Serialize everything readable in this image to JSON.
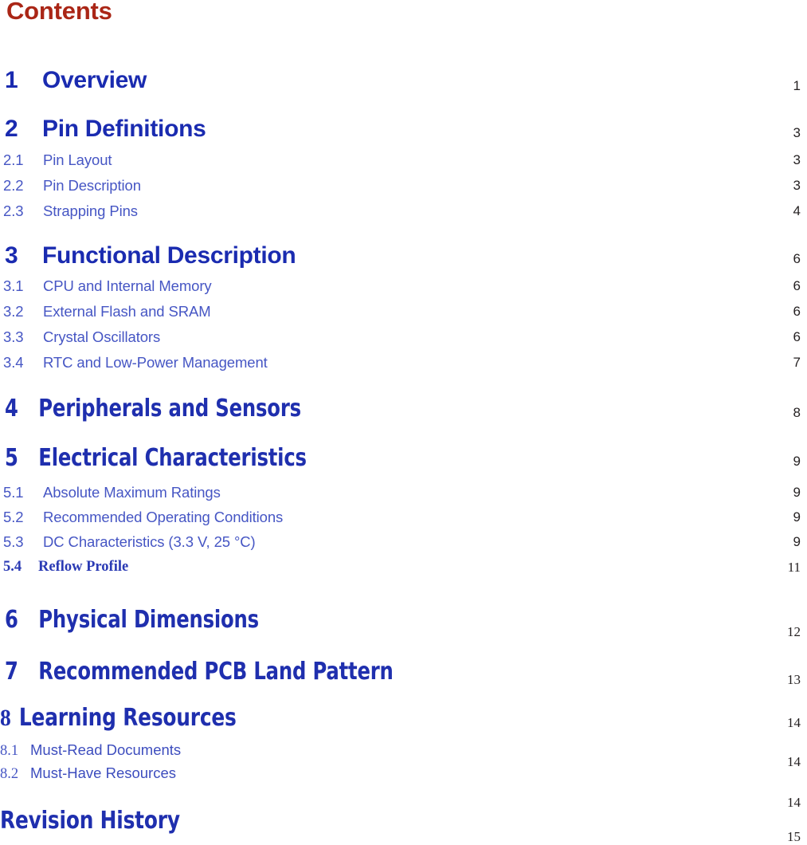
{
  "document": {
    "title": "Contents",
    "title_color": "#aa2616",
    "section_color": "#1f2fae",
    "subsection_color": "#4656c4",
    "pagenum_color": "#231f20"
  },
  "entries": [
    {
      "id": "overview",
      "number": "1",
      "label": "Overview",
      "page": "1",
      "level": 1
    },
    {
      "id": "pin-definitions",
      "number": "2",
      "label": "Pin Definitions",
      "page": "3",
      "level": 1
    },
    {
      "id": "pin-layout",
      "number": "2.1",
      "label": "Pin Layout",
      "page": "3",
      "level": 2
    },
    {
      "id": "pin-description",
      "number": "2.2",
      "label": "Pin Description",
      "page": "3",
      "level": 2
    },
    {
      "id": "strapping-pins",
      "number": "2.3",
      "label": "Strapping Pins",
      "page": "4",
      "level": 2
    },
    {
      "id": "functional-description",
      "number": "3",
      "label": "Functional Description",
      "page": "6",
      "level": 1
    },
    {
      "id": "cpu-internal-memory",
      "number": "3.1",
      "label": "CPU and Internal Memory",
      "page": "6",
      "level": 2
    },
    {
      "id": "external-flash-sram",
      "number": "3.2",
      "label": "External Flash and SRAM",
      "page": "6",
      "level": 2
    },
    {
      "id": "crystal-oscillators",
      "number": "3.3",
      "label": "Crystal Oscillators",
      "page": "6",
      "level": 2
    },
    {
      "id": "rtc-low-power",
      "number": "3.4",
      "label": "RTC and Low-Power Management",
      "page": "7",
      "level": 2
    },
    {
      "id": "peripherals-sensors",
      "number": "4",
      "label": "Peripherals and Sensors",
      "page": "8",
      "level": 1
    },
    {
      "id": "electrical-characteristics",
      "number": "5",
      "label": "Electrical Characteristics",
      "page": "9",
      "level": 1
    },
    {
      "id": "absolute-maximum-ratings",
      "number": "5.1",
      "label": "Absolute Maximum Ratings",
      "page": "9",
      "level": 2
    },
    {
      "id": "recommended-operating-conditions",
      "number": "5.2",
      "label": "Recommended Operating Conditions",
      "page": "9",
      "level": 2
    },
    {
      "id": "dc-characteristics",
      "number": "5.3",
      "label": "DC Characteristics (3.3 V, 25 °C)",
      "page": "9",
      "level": 2
    },
    {
      "id": "reflow-profile",
      "number": "5.4",
      "label": "Reflow Profile",
      "page": "11",
      "level": 2
    },
    {
      "id": "physical-dimensions",
      "number": "6",
      "label": "Physical Dimensions",
      "page": "12",
      "level": 1
    },
    {
      "id": "recommended-pcb-land-pattern",
      "number": "7",
      "label": "Recommended PCB Land Pattern",
      "page": "13",
      "level": 1
    },
    {
      "id": "learning-resources",
      "number": "8",
      "label": "Learning Resources",
      "page": "14",
      "level": 1
    },
    {
      "id": "must-read-documents",
      "number": "8.1",
      "label": "Must-Read Documents",
      "page": "14",
      "level": 2
    },
    {
      "id": "must-have-resources",
      "number": "8.2",
      "label": "Must-Have Resources",
      "page": "14",
      "level": 2
    },
    {
      "id": "revision-history",
      "number": "",
      "label": "Revision History",
      "page": "15",
      "level": 1
    }
  ]
}
